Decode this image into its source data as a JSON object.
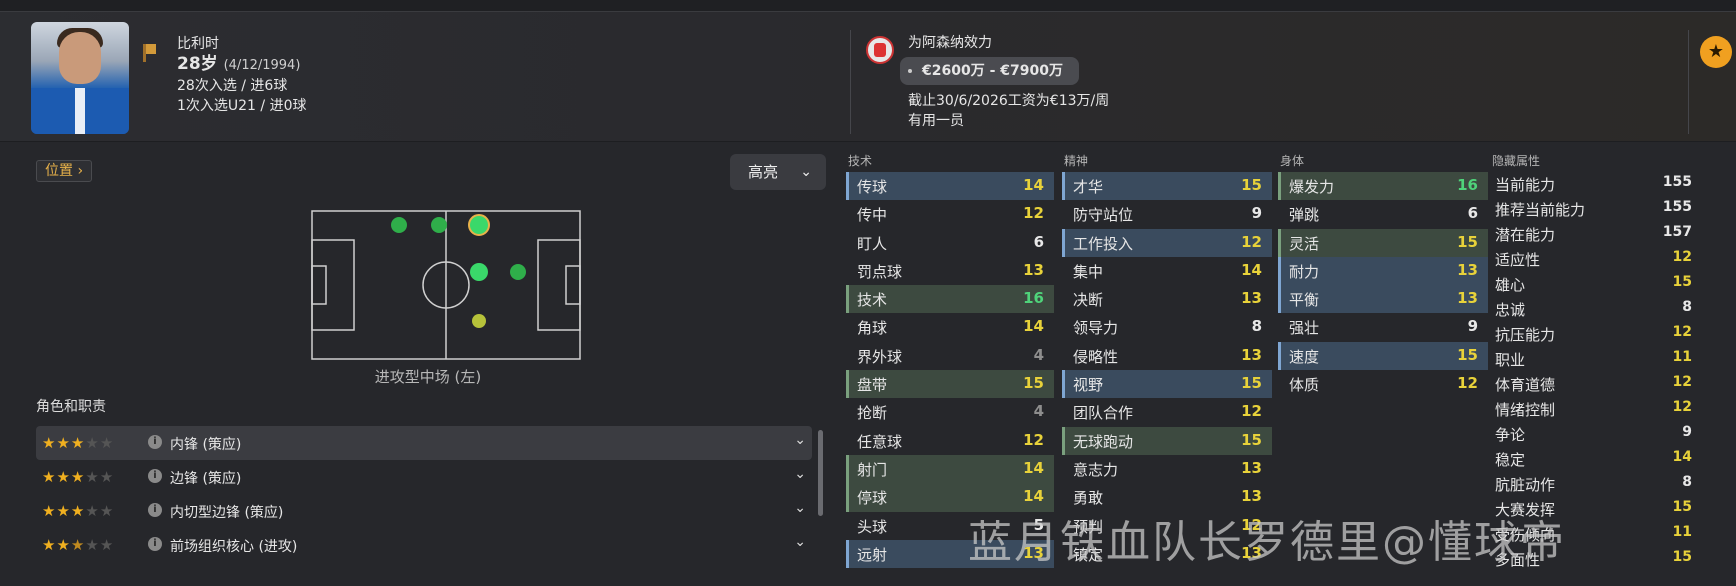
{
  "player": {
    "nationality": "比利时",
    "age": "28岁",
    "dob": "(4/12/1994)",
    "caps": "28次入选 / 进6球",
    "u21_caps": "1次入选U21 / 进0球"
  },
  "club": {
    "plays_for": "为阿森纳效力",
    "value": "€2600万 - €7900万",
    "contract": "截止30/6/2026工资为€13万/周",
    "status": "有用一员"
  },
  "colors": {
    "accent": "#e8b24a",
    "good": "#4fd37a",
    "ok": "#e8d23a"
  },
  "left": {
    "position_button": "位置",
    "highlight_button": "高亮",
    "position_label": "进攻型中场 (左)",
    "roles_title": "角色和职责",
    "roles": [
      {
        "stars": 3,
        "name": "内锋 (策应)"
      },
      {
        "stars": 3,
        "name": "边锋 (策应)"
      },
      {
        "stars": 3,
        "name": "内切型边锋 (策应)"
      },
      {
        "stars": 2.5,
        "name": "前场组织核心 (进攻)"
      }
    ]
  },
  "attributes": {
    "technical": {
      "title": "技术",
      "items": [
        {
          "name": "传球",
          "value": "14",
          "hl": "b",
          "tone": "y"
        },
        {
          "name": "传中",
          "value": "12",
          "hl": "",
          "tone": "y"
        },
        {
          "name": "盯人",
          "value": "6",
          "hl": "",
          "tone": "w"
        },
        {
          "name": "罚点球",
          "value": "13",
          "hl": "",
          "tone": "y"
        },
        {
          "name": "技术",
          "value": "16",
          "hl": "g",
          "tone": "g"
        },
        {
          "name": "角球",
          "value": "14",
          "hl": "",
          "tone": "y"
        },
        {
          "name": "界外球",
          "value": "4",
          "hl": "",
          "tone": "d"
        },
        {
          "name": "盘带",
          "value": "15",
          "hl": "g",
          "tone": "y"
        },
        {
          "name": "抢断",
          "value": "4",
          "hl": "",
          "tone": "d"
        },
        {
          "name": "任意球",
          "value": "12",
          "hl": "",
          "tone": "y"
        },
        {
          "name": "射门",
          "value": "14",
          "hl": "g",
          "tone": "y"
        },
        {
          "name": "停球",
          "value": "14",
          "hl": "g",
          "tone": "y"
        },
        {
          "name": "头球",
          "value": "5",
          "hl": "",
          "tone": "w"
        },
        {
          "name": "远射",
          "value": "13",
          "hl": "b",
          "tone": "y"
        }
      ]
    },
    "mental": {
      "title": "精神",
      "items": [
        {
          "name": "才华",
          "value": "15",
          "hl": "b",
          "tone": "y"
        },
        {
          "name": "防守站位",
          "value": "9",
          "hl": "",
          "tone": "w"
        },
        {
          "name": "工作投入",
          "value": "12",
          "hl": "b",
          "tone": "y"
        },
        {
          "name": "集中",
          "value": "14",
          "hl": "",
          "tone": "y"
        },
        {
          "name": "决断",
          "value": "13",
          "hl": "",
          "tone": "y"
        },
        {
          "name": "领导力",
          "value": "8",
          "hl": "",
          "tone": "w"
        },
        {
          "name": "侵略性",
          "value": "13",
          "hl": "",
          "tone": "y"
        },
        {
          "name": "视野",
          "value": "15",
          "hl": "b",
          "tone": "y"
        },
        {
          "name": "团队合作",
          "value": "12",
          "hl": "",
          "tone": "y"
        },
        {
          "name": "无球跑动",
          "value": "15",
          "hl": "g",
          "tone": "y"
        },
        {
          "name": "意志力",
          "value": "13",
          "hl": "",
          "tone": "y"
        },
        {
          "name": "勇敢",
          "value": "13",
          "hl": "",
          "tone": "y"
        },
        {
          "name": "预判",
          "value": "12",
          "hl": "",
          "tone": "y"
        },
        {
          "name": "镇定",
          "value": "13",
          "hl": "",
          "tone": "y"
        }
      ]
    },
    "physical": {
      "title": "身体",
      "items": [
        {
          "name": "爆发力",
          "value": "16",
          "hl": "g",
          "tone": "g"
        },
        {
          "name": "弹跳",
          "value": "6",
          "hl": "",
          "tone": "w"
        },
        {
          "name": "灵活",
          "value": "15",
          "hl": "g",
          "tone": "y"
        },
        {
          "name": "耐力",
          "value": "13",
          "hl": "b",
          "tone": "y"
        },
        {
          "name": "平衡",
          "value": "13",
          "hl": "b",
          "tone": "y"
        },
        {
          "name": "强壮",
          "value": "9",
          "hl": "",
          "tone": "w"
        },
        {
          "name": "速度",
          "value": "15",
          "hl": "b",
          "tone": "y"
        },
        {
          "name": "体质",
          "value": "12",
          "hl": "",
          "tone": "y"
        }
      ]
    },
    "hidden": {
      "title": "隐藏属性",
      "items": [
        {
          "name": "当前能力",
          "value": "155",
          "tone": "w"
        },
        {
          "name": "推荐当前能力",
          "value": "155",
          "tone": "w"
        },
        {
          "name": "潜在能力",
          "value": "157",
          "tone": "w"
        },
        {
          "name": "适应性",
          "value": "12",
          "tone": "y"
        },
        {
          "name": "雄心",
          "value": "15",
          "tone": "y"
        },
        {
          "name": "忠诚",
          "value": "8",
          "tone": "w"
        },
        {
          "name": "抗压能力",
          "value": "12",
          "tone": "y"
        },
        {
          "name": "职业",
          "value": "11",
          "tone": "y"
        },
        {
          "name": "体育道德",
          "value": "12",
          "tone": "y"
        },
        {
          "name": "情绪控制",
          "value": "12",
          "tone": "y"
        },
        {
          "name": "争论",
          "value": "9",
          "tone": "w"
        },
        {
          "name": "稳定",
          "value": "14",
          "tone": "y"
        },
        {
          "name": "肮脏动作",
          "value": "8",
          "tone": "w"
        },
        {
          "name": "大赛发挥",
          "value": "15",
          "tone": "y"
        },
        {
          "name": "受伤倾向",
          "value": "11",
          "tone": "y"
        },
        {
          "name": "多面性",
          "value": "15",
          "tone": "y"
        }
      ]
    }
  },
  "watermark": "蓝月铁血队长罗德里@懂球帝"
}
